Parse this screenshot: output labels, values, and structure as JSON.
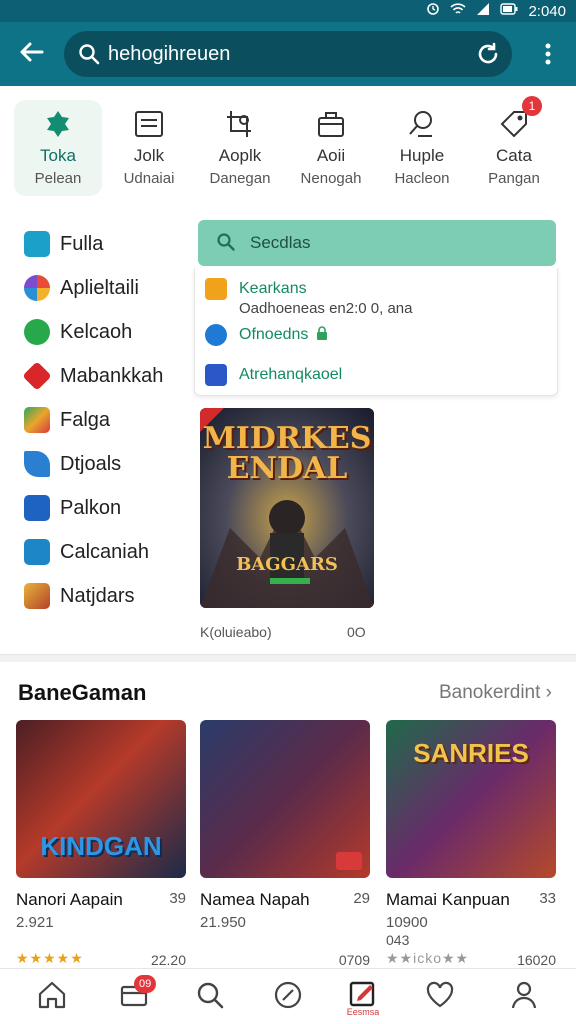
{
  "status_bar": {
    "time": "2:040"
  },
  "search": {
    "query": "hehogihreuen"
  },
  "categories": [
    {
      "label": "Toka",
      "sub": "Pelean"
    },
    {
      "label": "Jolk",
      "sub": "Udnaiai"
    },
    {
      "label": "Aoplk",
      "sub": "Danegan"
    },
    {
      "label": "Aoii",
      "sub": "Nenogah"
    },
    {
      "label": "Huple",
      "sub": "Hacleon"
    },
    {
      "label": "Cata",
      "sub": "Pangan",
      "badge": "1"
    }
  ],
  "sidebar": {
    "items": [
      {
        "label": "Fulla",
        "icon": "flag-icon",
        "color": "#1aa0c9"
      },
      {
        "label": "Aplieltaili",
        "icon": "pinwheel-icon",
        "color": "#e8a43a"
      },
      {
        "label": "Kelcaoh",
        "icon": "refresh-icon",
        "color": "#27a84a"
      },
      {
        "label": "Mabankkah",
        "icon": "diamond-icon",
        "color": "#d8262b"
      },
      {
        "label": "Falga",
        "icon": "play-icon",
        "color": "#2fa75a"
      },
      {
        "label": "Dtjoals",
        "icon": "feather-icon",
        "color": "#2a7fd0"
      },
      {
        "label": "Palkon",
        "icon": "swap-icon",
        "color": "#1f63c0"
      },
      {
        "label": "Calcaniah",
        "icon": "arrow-icon",
        "color": "#1d86c7"
      },
      {
        "label": "Natjdars",
        "icon": "game-icon",
        "color": "#b34228"
      }
    ]
  },
  "results": {
    "header": "Secdlas",
    "items": [
      {
        "title": "Kearkans",
        "meta": "Oadhoeneas en2:0 0, ana",
        "icon": "cat-icon",
        "color": "#f0a21a"
      },
      {
        "title": "Ofnoedns",
        "icon": "globe-icon",
        "color": "#1f7ad6"
      },
      {
        "title": "Atrehanqkaoel",
        "icon": "feather-icon",
        "color": "#2a58c9"
      }
    ]
  },
  "featured": {
    "title_line1": "MIDRKES",
    "title_line2": "ENDAL",
    "bottom_text": "BAGGARS",
    "caption": "K(oluieabo)",
    "extra": "0O"
  },
  "section": {
    "title": "BaneGaman",
    "link": "Banokerdint"
  },
  "games": [
    {
      "art_title": "KINDGAN",
      "name": "Nanori Aapain",
      "count": "39",
      "sub1": "2.921",
      "sub2": "",
      "rating": "★★★★★",
      "right": "22.20",
      "accent": "#2e97e3"
    },
    {
      "art_title": "",
      "name": "Namea Napah",
      "count": "29",
      "sub1": "21.950",
      "sub2": "",
      "rating": "",
      "right": "0709",
      "accent": "#c6d2e5"
    },
    {
      "art_title": "SANRIES",
      "name": "Mamai Kanpuan",
      "count": "33",
      "sub1": "10900",
      "sub2": "043",
      "rating": "★★icko★★",
      "right": "16020",
      "accent": "#f3c44c"
    }
  ],
  "nav": {
    "badge": "09",
    "active_label": "Eesmsa"
  }
}
